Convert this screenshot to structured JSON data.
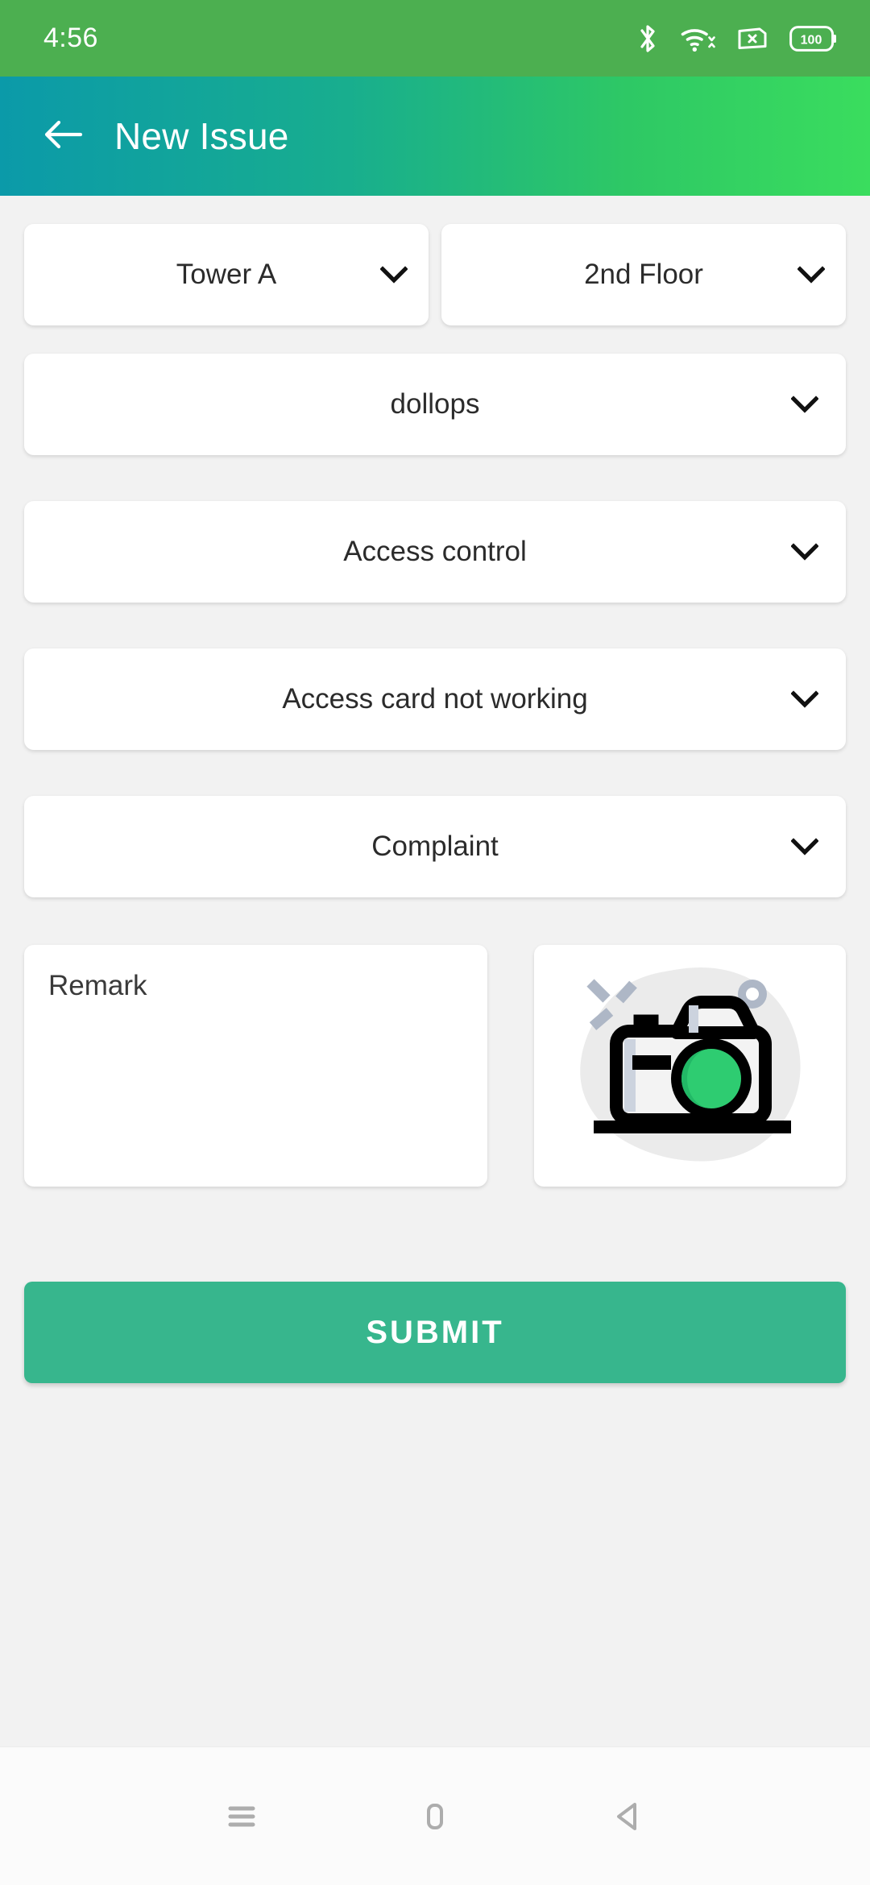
{
  "status_bar": {
    "time": "4:56",
    "battery_level": "100",
    "icons": [
      "bluetooth-icon",
      "wifi-icon",
      "sim-card-icon",
      "battery-icon"
    ],
    "background_color": "#4caf50"
  },
  "app_bar": {
    "back_icon": "back-arrow-icon",
    "title": "New Issue",
    "gradient_start": "#0b9aa9",
    "gradient_end": "#3add5e"
  },
  "form": {
    "tower_select": {
      "value": "Tower A",
      "chevron": "chevron-down-icon"
    },
    "floor_select": {
      "value": "2nd Floor",
      "chevron": "chevron-down-icon"
    },
    "unit_select": {
      "value": "dollops",
      "chevron": "chevron-down-icon"
    },
    "category_select": {
      "value": "Access control",
      "chevron": "chevron-down-icon"
    },
    "issue_select": {
      "value": "Access card not working",
      "chevron": "chevron-down-icon"
    },
    "type_select": {
      "value": "Complaint",
      "chevron": "chevron-down-icon"
    },
    "remark_field": {
      "placeholder": "Remark",
      "value": ""
    },
    "camera_button": {
      "icon": "camera-icon",
      "lens_color": "#2ecc71"
    },
    "submit_button": {
      "label": "SUBMIT",
      "color": "#37b68d"
    }
  },
  "nav_bar": {
    "recents": "recents-icon",
    "home": "home-icon",
    "back": "back-nav-icon"
  },
  "colors": {
    "page_background": "#f2f2f2",
    "card_background": "#ffffff",
    "text_primary": "#2b2b2b"
  }
}
